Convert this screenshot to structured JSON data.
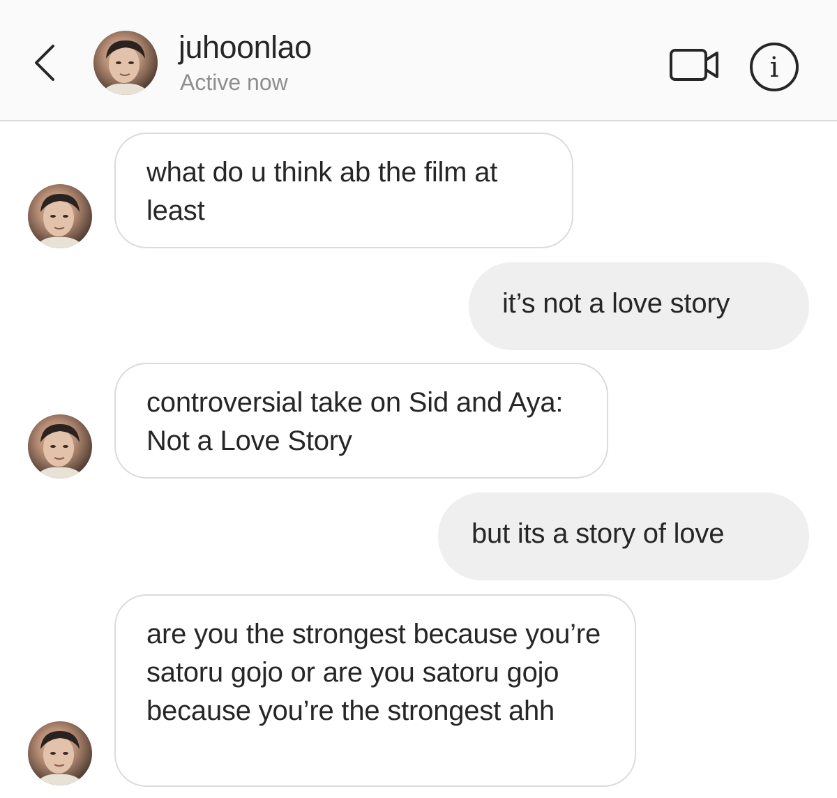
{
  "header": {
    "username": "juhoonlao",
    "status": "Active now",
    "back_icon": "chevron-left-icon",
    "video_icon": "video-camera-icon",
    "info_icon": "info-icon"
  },
  "colors": {
    "header_bg": "#fafafa",
    "outgoing_bubble": "#efefef",
    "incoming_border": "#dbdbdb",
    "secondary_text": "#8e8e8e"
  },
  "messages": [
    {
      "direction": "incoming",
      "text": "what do u think ab the film at least"
    },
    {
      "direction": "outgoing",
      "text": "it’s not a love story"
    },
    {
      "direction": "incoming",
      "text": "controversial take on Sid and Aya: Not a Love Story"
    },
    {
      "direction": "outgoing",
      "text": "but its a story of love"
    },
    {
      "direction": "incoming",
      "text": "are you the strongest because you’re satoru gojo or are you satoru gojo because you’re the strongest ahh"
    }
  ]
}
